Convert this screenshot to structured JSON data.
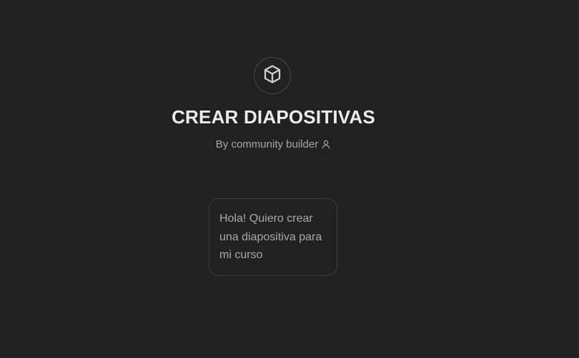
{
  "gpt": {
    "logo_icon": "cube-icon",
    "title": "CREAR DIAPOSITIVAS",
    "byline": "By community builder",
    "byline_icon": "person-icon"
  },
  "conversation_starters": [
    {
      "text": "Hola! Quiero crear una diapositiva para mi curso"
    }
  ],
  "colors": {
    "background": "#212121",
    "title": "#ececec",
    "muted_text": "#a6a6a6",
    "border": "#3d3d3d"
  }
}
